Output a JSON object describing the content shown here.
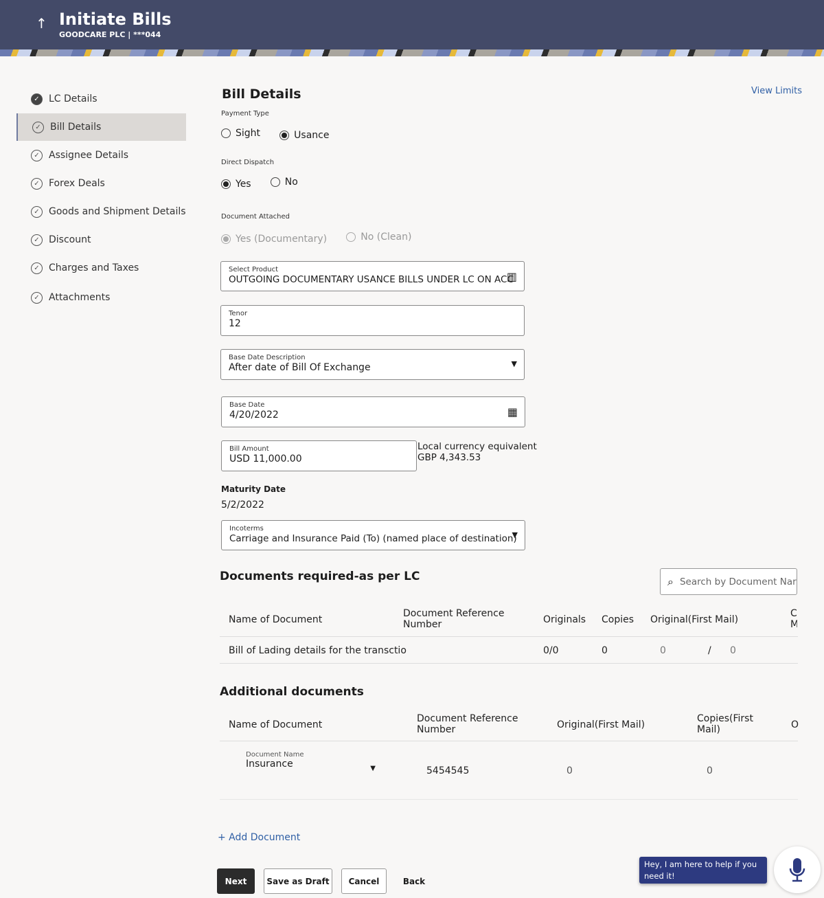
{
  "header": {
    "title": "Initiate Bills",
    "subtitle": "GOODCARE PLC | ***044"
  },
  "sidebar": {
    "items": [
      {
        "label": "LC Details"
      },
      {
        "label": "Bill Details"
      },
      {
        "label": "Assignee Details"
      },
      {
        "label": "Forex Deals"
      },
      {
        "label": "Goods and Shipment Details"
      },
      {
        "label": "Discount"
      },
      {
        "label": "Charges and Taxes"
      },
      {
        "label": "Attachments"
      }
    ]
  },
  "main": {
    "title": "Bill Details",
    "view_limits": "View Limits",
    "payment_type": {
      "label": "Payment Type",
      "options": [
        "Sight",
        "Usance"
      ],
      "selected": "Usance"
    },
    "direct_dispatch": {
      "label": "Direct Dispatch",
      "options": [
        "Yes",
        "No"
      ],
      "selected": "Yes"
    },
    "document_attached": {
      "label": "Document Attached",
      "options": [
        "Yes (Documentary)",
        "No (Clean)"
      ],
      "selected": "Yes (Documentary)"
    },
    "product": {
      "label": "Select Product",
      "value": "OUTGOING DOCUMENTARY USANCE BILLS UNDER LC ON ACC"
    },
    "tenor": {
      "label": "Tenor",
      "value": "12"
    },
    "base_date_desc": {
      "label": "Base Date Description",
      "value": "After date of Bill Of Exchange"
    },
    "base_date": {
      "label": "Base Date",
      "value": "4/20/2022"
    },
    "bill_amount": {
      "label": "Bill Amount",
      "value": "USD 11,000.00"
    },
    "local_equiv": {
      "label": "Local currency equivalent",
      "value": "GBP 4,343.53"
    },
    "maturity": {
      "label": "Maturity Date",
      "value": "5/2/2022"
    },
    "incoterms": {
      "label": "Incoterms",
      "value": "Carriage and Insurance Paid (To) (named place of destination)"
    },
    "docs_title": "Documents required-as per LC",
    "search_placeholder": "Search by Document Nar",
    "docs_headers": [
      "Name of Document",
      "Document Reference Number",
      "Originals",
      "Copies",
      "Original(First Mail)",
      "C M"
    ],
    "docs_rows": [
      {
        "name": "Bill of Lading details for the transctio",
        "ref": "",
        "originals": "0/0",
        "copies": "0",
        "first_mail_a": "0",
        "sep": "/",
        "first_mail_b": "0"
      }
    ],
    "add_title": "Additional documents",
    "add_headers": [
      "Name of Document",
      "Document Reference Number",
      "Original(First Mail)",
      "Copies(First Mail)",
      "O"
    ],
    "add_rows": [
      {
        "name_label": "Document Name",
        "name": "Insurance",
        "ref": "5454545",
        "orig": "0",
        "copies": "0"
      }
    ],
    "add_document": "+ Add Document",
    "buttons": {
      "next": "Next",
      "draft": "Save as Draft",
      "cancel": "Cancel",
      "back": "Back"
    }
  },
  "chat": {
    "message": "Hey, I am here to help if you need it!"
  }
}
